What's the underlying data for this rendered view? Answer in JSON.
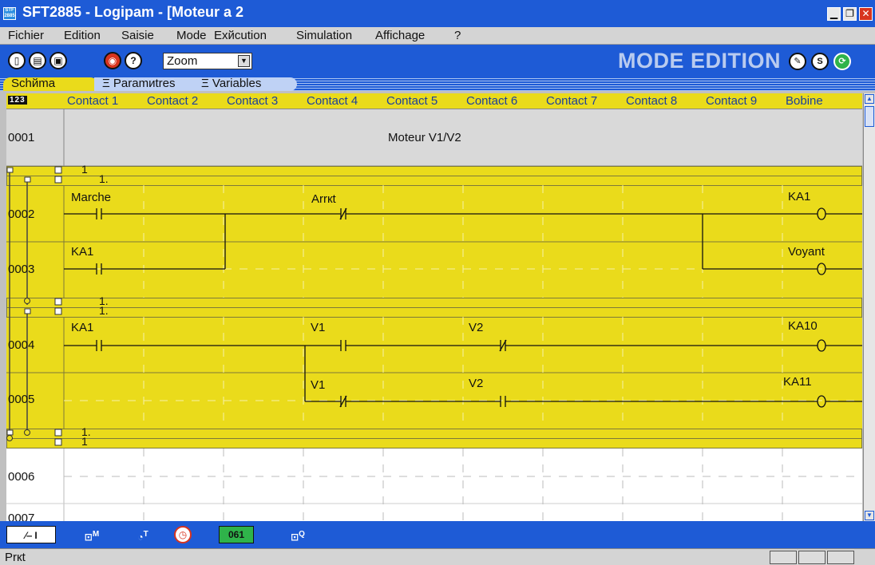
{
  "window": {
    "icon_text": "STF 2885",
    "title": "SFT2885 - Logipam - [Moteur a 2"
  },
  "menu": [
    "Fichier",
    "Edition",
    "Saisie",
    "Mode",
    "Exйcution",
    "Simulation",
    "Affichage",
    "?"
  ],
  "toolbar": {
    "zoom_label": "Zoom",
    "mode_label": "MODE EDITION",
    "s_label": "S"
  },
  "tabs": [
    "Schйma",
    "Paramиtres",
    "Variables"
  ],
  "header": {
    "num_label": "123",
    "columns": [
      "Contact 1",
      "Contact 2",
      "Contact 3",
      "Contact 4",
      "Contact 5",
      "Contact 6",
      "Contact 7",
      "Contact 8",
      "Contact 9",
      "Bobine"
    ]
  },
  "ladder": {
    "comment_row": "0001",
    "comment_text": "Moteur V1/V2",
    "rungs": [
      {
        "row": "0002",
        "labels": [
          {
            "text": "Marche"
          },
          {
            "text": "Arrкt"
          },
          {
            "text": "KA1"
          }
        ]
      },
      {
        "row": "0003",
        "labels": [
          {
            "text": "KA1"
          },
          {
            "text": "Voyant"
          }
        ]
      },
      {
        "row": "0004",
        "labels": [
          {
            "text": "KA1"
          },
          {
            "text": "V1"
          },
          {
            "text": "V2"
          },
          {
            "text": "KA10"
          }
        ]
      },
      {
        "row": "0005",
        "labels": [
          {
            "text": "V1"
          },
          {
            "text": "V2"
          },
          {
            "text": "KA11"
          }
        ]
      }
    ],
    "block_markers": [
      "1",
      "1.",
      "1.",
      "1.",
      "1.",
      "1"
    ],
    "empty_rows": [
      "0006",
      "0007"
    ]
  },
  "bottom_tools": [
    "I",
    "M",
    "T",
    "",
    "061",
    "Q"
  ],
  "status": {
    "text": "Prкt"
  },
  "colors": {
    "blue": "#1e5bd6",
    "yellow": "#eadb1b",
    "grid_blue": "#1b3f9c"
  }
}
